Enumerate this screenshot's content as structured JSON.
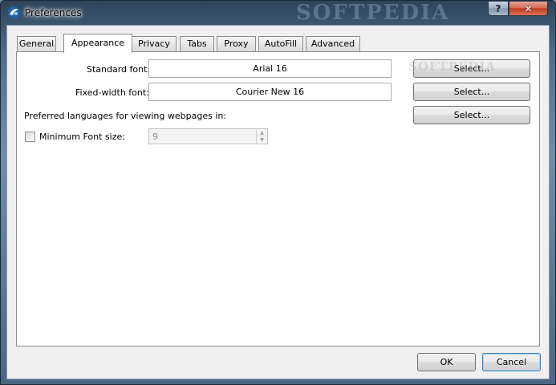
{
  "window": {
    "title": "Preferences",
    "watermark": "SOFTPEDIA",
    "help_glyph": "?",
    "close_glyph": "✕"
  },
  "tabs": [
    {
      "label": "General"
    },
    {
      "label": "Appearance"
    },
    {
      "label": "Privacy"
    },
    {
      "label": "Tabs"
    },
    {
      "label": "Proxy"
    },
    {
      "label": "AutoFill"
    },
    {
      "label": "Advanced"
    }
  ],
  "appearance": {
    "standard_font_label": "Standard font:",
    "standard_font_value": "Arial 16",
    "fixed_font_label": "Fixed-width font:",
    "fixed_font_value": "Courier New 16",
    "languages_label": "Preferred languages for viewing webpages in:",
    "select_label": "Select...",
    "min_font_label": "Minimum Font size:",
    "min_font_value": "9",
    "min_font_checked": false,
    "min_font_enabled": false
  },
  "footer": {
    "ok_label": "OK",
    "cancel_label": "Cancel"
  },
  "icons": {
    "app": "app-icon",
    "help": "help-icon",
    "close": "close-icon",
    "spin_up": "spin-up-icon",
    "spin_down": "spin-down-icon"
  },
  "colors": {
    "titlebar": "#4f6e8c",
    "close_button": "#c2371c",
    "default_button_border": "#3c7fb1",
    "tab_active": "#ffffff"
  }
}
